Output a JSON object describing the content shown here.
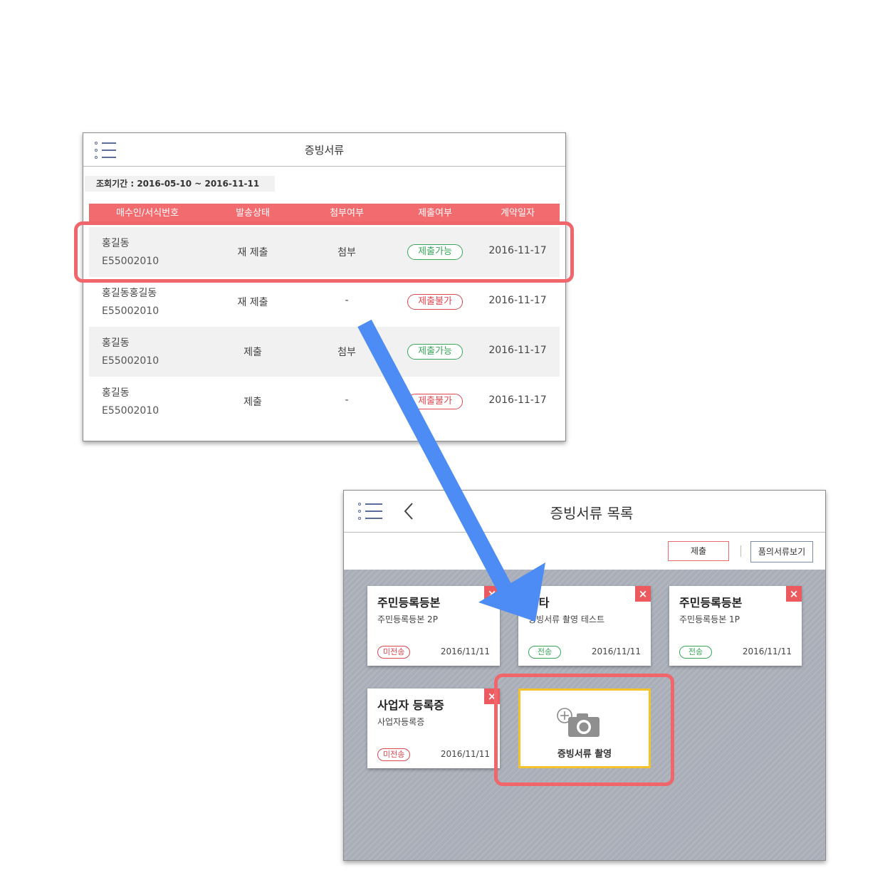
{
  "screen1": {
    "title": "증빙서류",
    "period": "조회기간 : 2016-05-10 ~ 2016-11-11",
    "columns": [
      "매수인/서식번호",
      "발송상태",
      "첨부여부",
      "제출여부",
      "계약일자"
    ],
    "rows": [
      {
        "name": "홍길동",
        "code": "E55002010",
        "send": "재 제출",
        "attach": "첨부",
        "submit": "제출가능",
        "date": "2016-11-17"
      },
      {
        "name": "홍길동홍길동",
        "code": "E55002010",
        "send": "재 제출",
        "attach": "-",
        "submit": "제출불가",
        "date": "2016-11-17"
      },
      {
        "name": "홍길동",
        "code": "E55002010",
        "send": "제출",
        "attach": "첨부",
        "submit": "제출가능",
        "date": "2016-11-17"
      },
      {
        "name": "홍길동",
        "code": "E55002010",
        "send": "제출",
        "attach": "-",
        "submit": "제출불가",
        "date": "2016-11-17"
      }
    ]
  },
  "screen2": {
    "title": "증빙서류 목록",
    "submit_label": "제출",
    "view_label": "품의서류보기",
    "cards": [
      {
        "title": "주민등록등본",
        "sub": "주민등록등본 2P",
        "status": "미전송",
        "date": "2016/11/11"
      },
      {
        "title": "기타",
        "sub": "증빙서류 촬영 테스트",
        "status": "전송",
        "date": "2016/11/11"
      },
      {
        "title": "주민등록등본",
        "sub": "주민등록등본 1P",
        "status": "전송",
        "date": "2016/11/11"
      },
      {
        "title": "사업자 등록증",
        "sub": "사업자등록증",
        "status": "미전송",
        "date": "2016/11/11"
      }
    ],
    "capture_label": "증빙서류 촬영"
  },
  "icons": {
    "menu": "menu-list-icon",
    "back": "chevron-left-icon",
    "close": "close-icon",
    "camera": "camera-plus-icon"
  },
  "colors": {
    "accent_red": "#f26b6f",
    "ok_green": "#3aa55a",
    "highlight_yellow": "#f5c22b",
    "arrow_blue": "#4d8cf5"
  }
}
